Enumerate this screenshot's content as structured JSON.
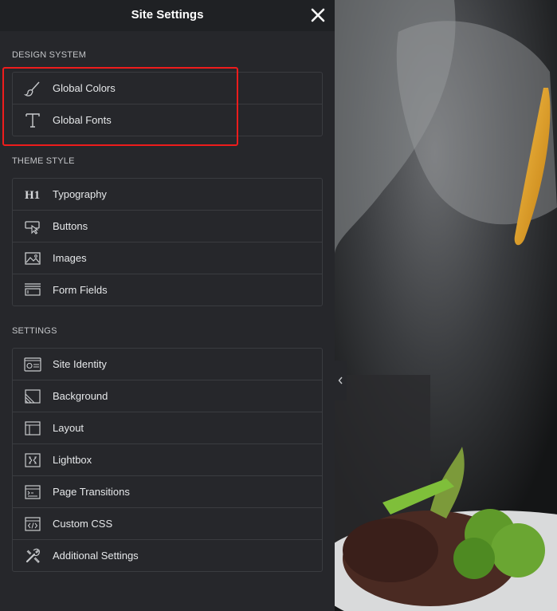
{
  "header": {
    "title": "Site Settings",
    "close_icon": "close-icon"
  },
  "sections": {
    "design_system": {
      "title": "DESIGN SYSTEM",
      "items": [
        {
          "label": "Global Colors",
          "icon": "brush-icon"
        },
        {
          "label": "Global Fonts",
          "icon": "text-t-icon"
        }
      ]
    },
    "theme_style": {
      "title": "THEME STYLE",
      "items": [
        {
          "label": "Typography",
          "icon": "h1-icon"
        },
        {
          "label": "Buttons",
          "icon": "button-cursor-icon"
        },
        {
          "label": "Images",
          "icon": "image-icon"
        },
        {
          "label": "Form Fields",
          "icon": "form-field-icon"
        }
      ]
    },
    "settings": {
      "title": "SETTINGS",
      "items": [
        {
          "label": "Site Identity",
          "icon": "site-identity-icon"
        },
        {
          "label": "Background",
          "icon": "background-icon"
        },
        {
          "label": "Layout",
          "icon": "layout-icon"
        },
        {
          "label": "Lightbox",
          "icon": "lightbox-icon"
        },
        {
          "label": "Page Transitions",
          "icon": "page-transitions-icon"
        },
        {
          "label": "Custom CSS",
          "icon": "code-icon"
        },
        {
          "label": "Additional Settings",
          "icon": "tools-icon"
        }
      ]
    }
  },
  "colors": {
    "panel_bg": "#26272b",
    "header_bg": "#1f2124",
    "border": "#3a3c40",
    "highlight": "#ee1c1c",
    "text": "#e6e8ea"
  }
}
